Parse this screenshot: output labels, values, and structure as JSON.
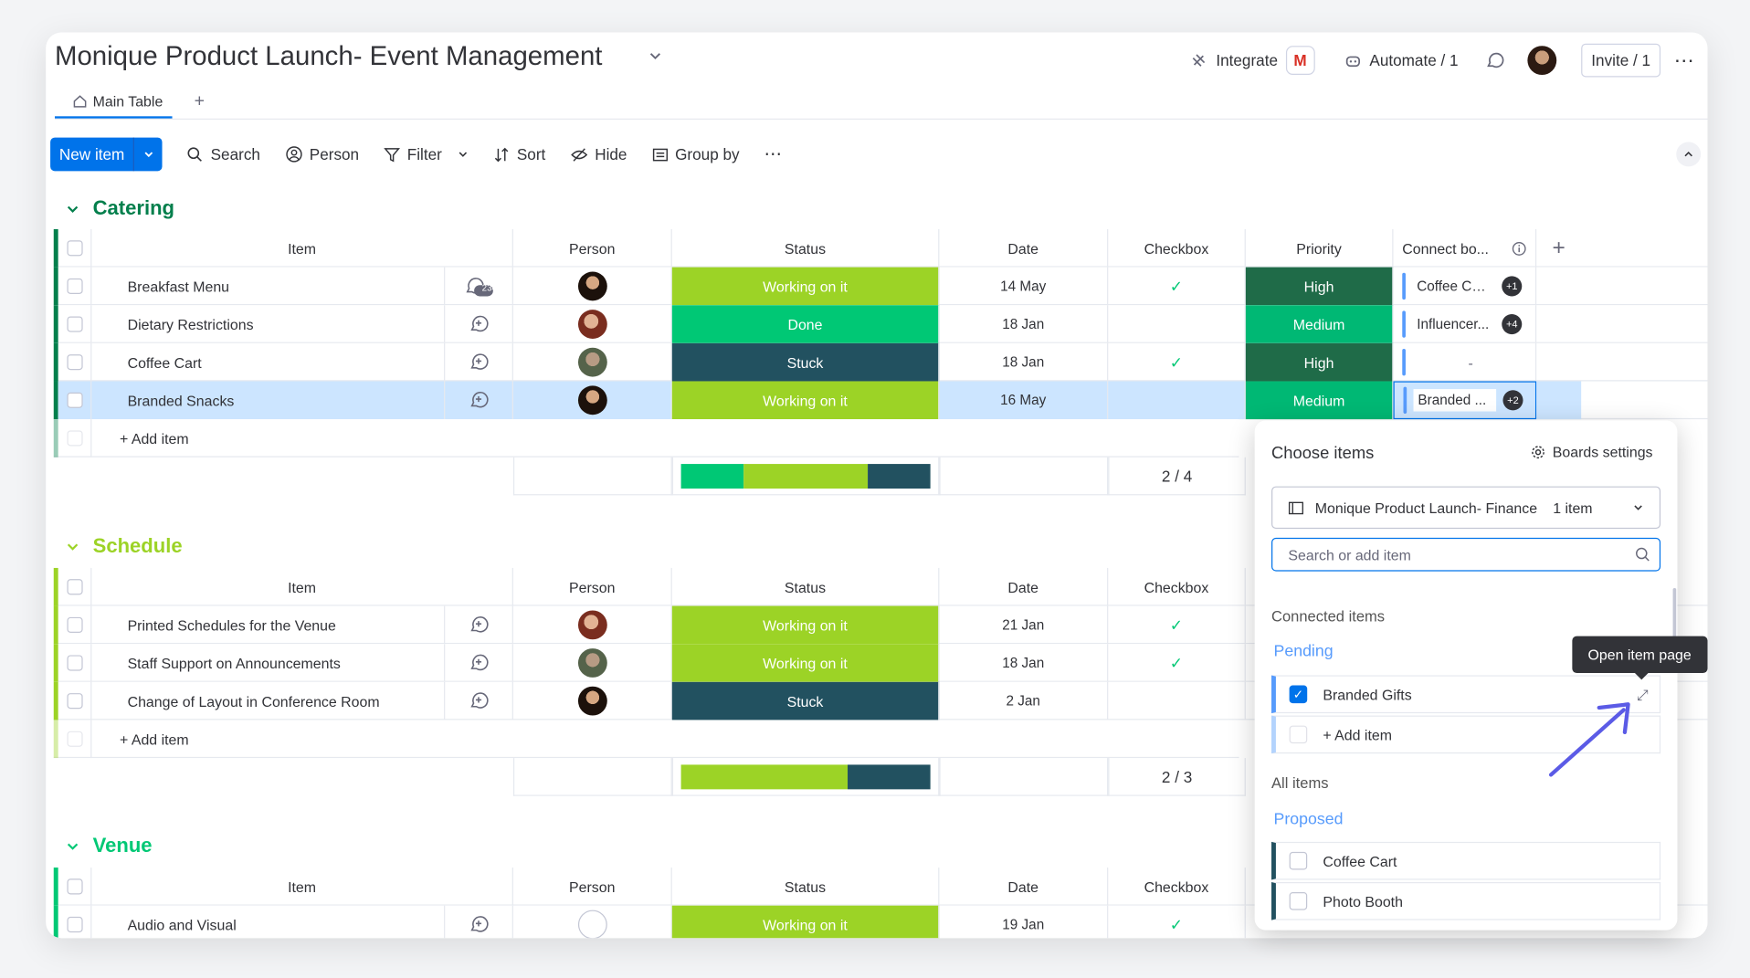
{
  "header": {
    "title": "Monique Product Launch- Event Management",
    "integrate": "Integrate",
    "gmail_letter": "M",
    "automate": "Automate / 1",
    "invite": "Invite / 1",
    "more": "⋯"
  },
  "tabs": {
    "main": "Main Table",
    "add": "+"
  },
  "toolbar": {
    "new_item": "New item",
    "search": "Search",
    "person": "Person",
    "filter": "Filter",
    "sort": "Sort",
    "hide": "Hide",
    "group_by": "Group by",
    "more": "⋯"
  },
  "columns": {
    "item": "Item",
    "person": "Person",
    "status": "Status",
    "date": "Date",
    "checkbox": "Checkbox",
    "priority": "Priority",
    "connect": "Connect bo...",
    "add": "+"
  },
  "groups": {
    "catering": {
      "title": "Catering",
      "color": "#037f4c",
      "rows": [
        {
          "item": "Breakfast Menu",
          "conv": "234",
          "status": "Working on it",
          "date": "14 May",
          "checked": true,
          "priority": "High",
          "connect": "Coffee Ca...",
          "badge": "+1"
        },
        {
          "item": "Dietary Restrictions",
          "conv": "",
          "status": "Done",
          "date": "18 Jan",
          "checked": false,
          "priority": "Medium",
          "connect": "Influencer...",
          "badge": "+4"
        },
        {
          "item": "Coffee Cart",
          "conv": "",
          "status": "Stuck",
          "date": "18 Jan",
          "checked": true,
          "priority": "High",
          "connect": "-",
          "badge": ""
        },
        {
          "item": "Branded Snacks",
          "conv": "",
          "status": "Working on it",
          "date": "16 May",
          "checked": false,
          "priority": "Medium",
          "connect": "Branded ...",
          "badge": "+2"
        }
      ],
      "add_item": "+ Add item",
      "checkbox_summary": "2 / 4",
      "status_summary": [
        {
          "label": "Done",
          "share": 0.25
        },
        {
          "label": "Working on it",
          "share": 0.5
        },
        {
          "label": "Stuck",
          "share": 0.25
        }
      ]
    },
    "schedule": {
      "title": "Schedule",
      "color": "#9cd326",
      "rows": [
        {
          "item": "Printed Schedules for the Venue",
          "status": "Working on it",
          "date": "21 Jan",
          "checked": true
        },
        {
          "item": "Staff Support on Announcements",
          "status": "Working on it",
          "date": "18 Jan",
          "checked": true
        },
        {
          "item": "Change of Layout in Conference Room",
          "status": "Stuck",
          "date": "2 Jan",
          "checked": false
        }
      ],
      "add_item": "+ Add item",
      "checkbox_summary": "2 / 3",
      "status_summary": [
        {
          "label": "Working on it",
          "share": 0.67
        },
        {
          "label": "Stuck",
          "share": 0.33
        }
      ]
    },
    "venue": {
      "title": "Venue",
      "color": "#00c875",
      "rows": [
        {
          "item": "Audio and Visual",
          "status": "Working on it",
          "date": "19 Jan",
          "checked": true
        }
      ]
    }
  },
  "popup": {
    "title": "Choose items",
    "settings": "Boards settings",
    "board_name": "Monique Product Launch- Finance",
    "board_count": "1 item",
    "search_placeholder": "Search or add item",
    "connected_label": "Connected items",
    "pending_label": "Pending",
    "pending_item": "Branded Gifts",
    "add_item": "+ Add item",
    "all_label": "All items",
    "proposed_label": "Proposed",
    "proposed_items": [
      "Coffee Cart",
      "Photo Booth"
    ]
  },
  "tooltip": "Open item page"
}
